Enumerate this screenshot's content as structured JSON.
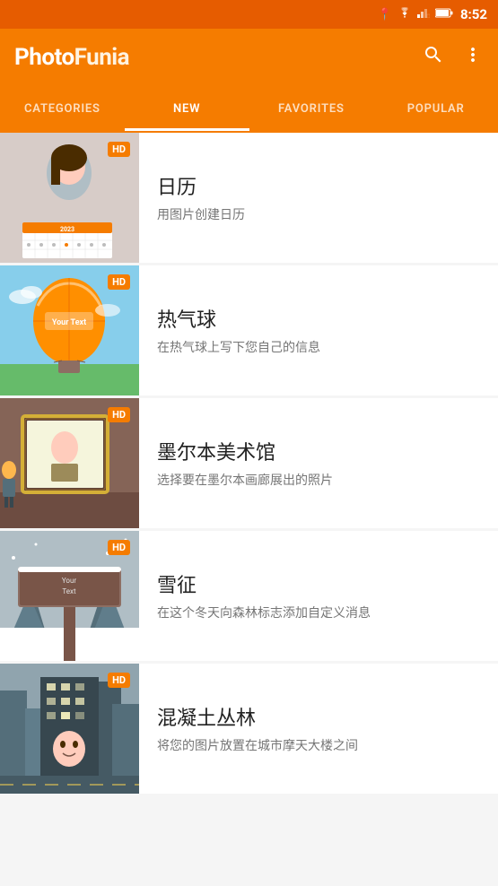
{
  "statusBar": {
    "time": "8:52",
    "icons": [
      "location",
      "wifi",
      "signal",
      "battery"
    ]
  },
  "appBar": {
    "logo": "PhotoFunia",
    "logoPhoto": "Photo",
    "logoFunia": "Funia",
    "searchLabel": "search",
    "moreLabel": "more"
  },
  "tabs": [
    {
      "id": "categories",
      "label": "CATEGORIES",
      "active": false
    },
    {
      "id": "new",
      "label": "NEW",
      "active": true
    },
    {
      "id": "favorites",
      "label": "FAVORITES",
      "active": false
    },
    {
      "id": "popular",
      "label": "POPULAR",
      "active": false
    }
  ],
  "items": [
    {
      "id": "calendar",
      "title": "日历",
      "desc": "用图片创建日历",
      "badge": "HD",
      "thumbType": "calendar"
    },
    {
      "id": "balloon",
      "title": "热气球",
      "desc": "在热气球上写下您自己的信息",
      "badge": "HD",
      "thumbType": "balloon"
    },
    {
      "id": "gallery",
      "title": "墨尔本美术馆",
      "desc": "选择要在墨尔本画廊展出的照片",
      "badge": "HD",
      "thumbType": "gallery"
    },
    {
      "id": "snow",
      "title": "雪征",
      "desc": "在这个冬天向森林标志添加自定义消息",
      "badge": "HD",
      "thumbType": "snow"
    },
    {
      "id": "city",
      "title": "混凝土丛林",
      "desc": "将您的图片放置在城市摩天大楼之间",
      "badge": "HD",
      "thumbType": "city"
    }
  ]
}
